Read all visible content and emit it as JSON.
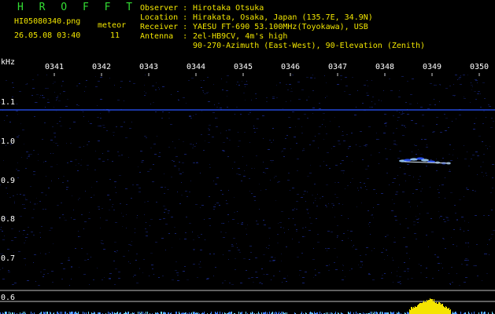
{
  "station": {
    "title": "H R O F F T",
    "filename": "HI05080340.png",
    "datetime": "26.05.08 03:40",
    "meteor_label": "meteor",
    "meteor_count": "11"
  },
  "info": {
    "observer_label": "Observer :",
    "observer_value": "Hirotaka Otsuka",
    "location_label": "Location :",
    "location_value": "Hirakata, Osaka, Japan (135.7E, 34.9N)",
    "receiver_label": "Receiver :",
    "receiver_value": "YAESU FT-690 53.100MHz(Toyokawa), USB",
    "antenna_label": "Antenna  :",
    "antenna_value": "2el-HB9CV, 4m's high",
    "antenna_line2": "90-270-Azimuth (East-West), 90-Elevation (Zenith)"
  },
  "axes": {
    "ylabel": "kHz",
    "time_ticks": [
      "0341",
      "0342",
      "0343",
      "0344",
      "0345",
      "0346",
      "0347",
      "0348",
      "0349",
      "0350"
    ],
    "freq_ticks": [
      "1.1",
      "1.0",
      "0.9",
      "0.8",
      "0.7",
      "0.6"
    ]
  },
  "colors": {
    "background": "#000000",
    "title": "#33dd33",
    "info_text": "#f2e600",
    "axis_text": "#ffffff",
    "noise": "#1a2a8a",
    "carrier": "#2a55ff",
    "echo": "#9fd0ff",
    "histogram": "#f5e400"
  }
}
